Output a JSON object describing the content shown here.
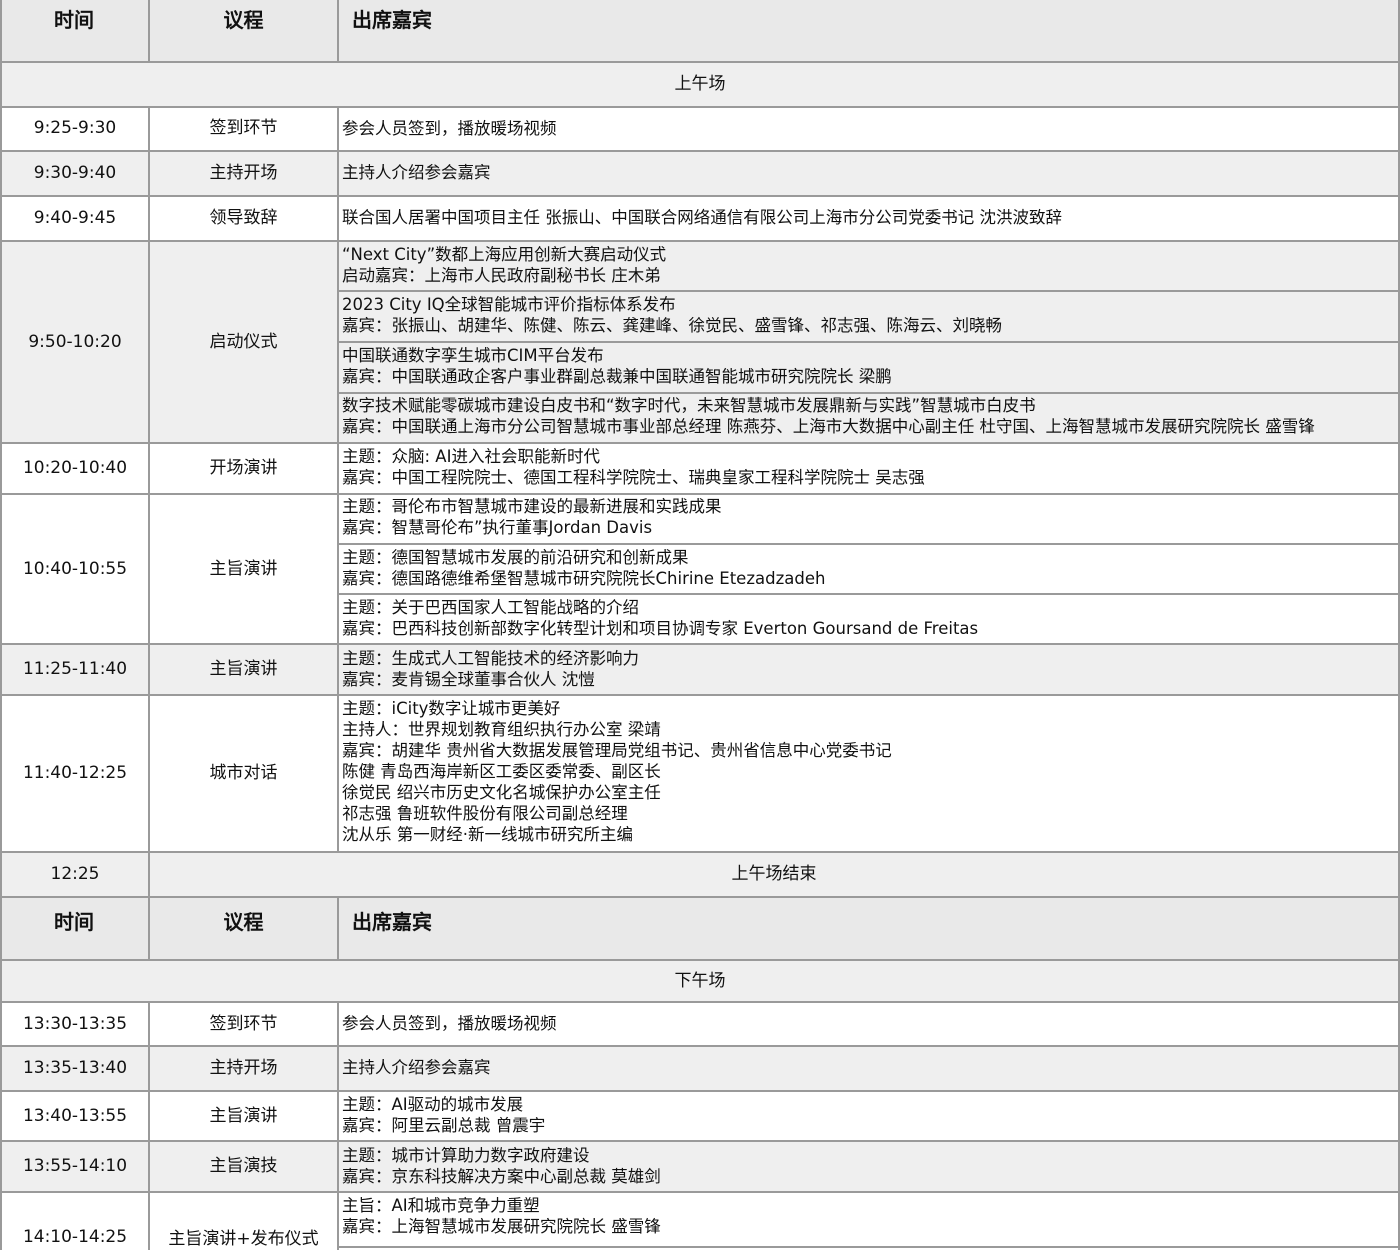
{
  "headers": {
    "am": {
      "time": "时间",
      "agenda": "议程",
      "guests": "出席嘉宾"
    },
    "pm": {
      "time": "时间",
      "agenda": "议程",
      "guests": "出席嘉宾"
    }
  },
  "sections": {
    "am": "上午场",
    "pm": "下午场"
  },
  "rows": [
    {
      "time": "9:25-9:30",
      "agenda": "签到环节",
      "blocks": [
        [
          "参会人员签到，播放暖场视频"
        ]
      ]
    },
    {
      "time": "9:30-9:40",
      "agenda": "主持开场",
      "blocks": [
        [
          "主持人介绍参会嘉宾"
        ]
      ]
    },
    {
      "time": "9:40-9:45",
      "agenda": "领导致辞",
      "blocks": [
        [
          "联合国人居署中国项目主任 张振山、中国联合网络通信有限公司上海市分公司党委书记 沈洪波致辞"
        ]
      ]
    },
    {
      "time": "9:50-10:20",
      "agenda": "启动仪式",
      "blocks": [
        [
          "“Next City”数都上海应用创新大赛启动仪式",
          "启动嘉宾：上海市人民政府副秘书长 庄木弟"
        ],
        [
          "2023 City IQ全球智能城市评价指标体系发布",
          "嘉宾：张振山、胡建华、陈健、陈云、龚建峰、徐觉民、盛雪锋、祁志强、陈海云、刘晓畅"
        ],
        [
          "中国联通数字孪生城市CIM平台发布",
          "嘉宾：中国联通政企客户事业群副总裁兼中国联通智能城市研究院院长 梁鹏"
        ],
        [
          "数字技术赋能零碳城市建设白皮书和“数字时代，未来智慧城市发展鼎新与实践”智慧城市白皮书",
          "嘉宾：中国联通上海市分公司智慧城市事业部总经理 陈燕芬、上海市大数据中心副主任 杜守国、上海智慧城市发展研究院院长 盛雪锋"
        ]
      ]
    },
    {
      "time": "10:20-10:40",
      "agenda": "开场演讲",
      "blocks": [
        [
          "主题：众脑: AI进入社会职能新时代",
          "嘉宾：中国工程院院士、德国工程科学院院士、瑞典皇家工程科学院院士 吴志强"
        ]
      ]
    },
    {
      "time": "10:40-10:55",
      "agenda": "主旨演讲",
      "blocks": [
        [
          "主题：哥伦布市智慧城市建设的最新进展和实践成果",
          "嘉宾：智慧哥伦布”执行董事Jordan Davis"
        ],
        [
          "主题：德国智慧城市发展的前沿研究和创新成果",
          "嘉宾：德国路德维希堡智慧城市研究院院长Chirine Etezadzadeh"
        ],
        [
          "主题：关于巴西国家人工智能战略的介绍",
          "嘉宾：巴西科技创新部数字化转型计划和项目协调专家  Everton Goursand de Freitas"
        ]
      ]
    },
    {
      "time": "11:25-11:40",
      "agenda": "主旨演讲",
      "blocks": [
        [
          "主题：生成式人工智能技术的经济影响力",
          "嘉宾：麦肯锡全球董事合伙人 沈愷"
        ]
      ]
    },
    {
      "time": "11:40-12:25",
      "agenda": "城市对话",
      "blocks": [
        [
          "主题：iCity数字让城市更美好",
          "主持人：世界规划教育组织执行办公室 梁靖",
          "嘉宾：胡建华 贵州省大数据发展管理局党组书记、贵州省信息中心党委书记",
          "陈健 青岛西海岸新区工委区委常委、副区长",
          "徐觉民 绍兴市历史文化名城保护办公室主任",
          "祁志强 鲁班软件股份有限公司副总经理",
          "沈从乐 第一财经·新一线城市研究所主编"
        ]
      ]
    },
    {
      "time": "13:30-13:35",
      "agenda": "签到环节",
      "blocks": [
        [
          "参会人员签到，播放暖场视频"
        ]
      ]
    },
    {
      "time": "13:35-13:40",
      "agenda": "主持开场",
      "blocks": [
        [
          "主持人介绍参会嘉宾"
        ]
      ]
    },
    {
      "time": "13:40-13:55",
      "agenda": "主旨演讲",
      "blocks": [
        [
          "主题：AI驱动的城市发展",
          "嘉宾：阿里云副总裁 曾震宇"
        ]
      ]
    },
    {
      "time": "13:55-14:10",
      "agenda": "主旨演技",
      "blocks": [
        [
          "主题：城市计算助力数字政府建设",
          "嘉宾：京东科技解决方案中心副总裁 莫雄剑"
        ]
      ]
    },
    {
      "time": "14:10-14:25",
      "agenda": "主旨演讲+发布仪式",
      "blocks": [
        [
          "主旨：AI和城市竞争力重塑",
          "嘉宾：上海智慧城市发展研究院院长 盛雪锋"
        ]
      ]
    }
  ],
  "end_row": {
    "time": "12:25",
    "text": "上午场结束"
  }
}
